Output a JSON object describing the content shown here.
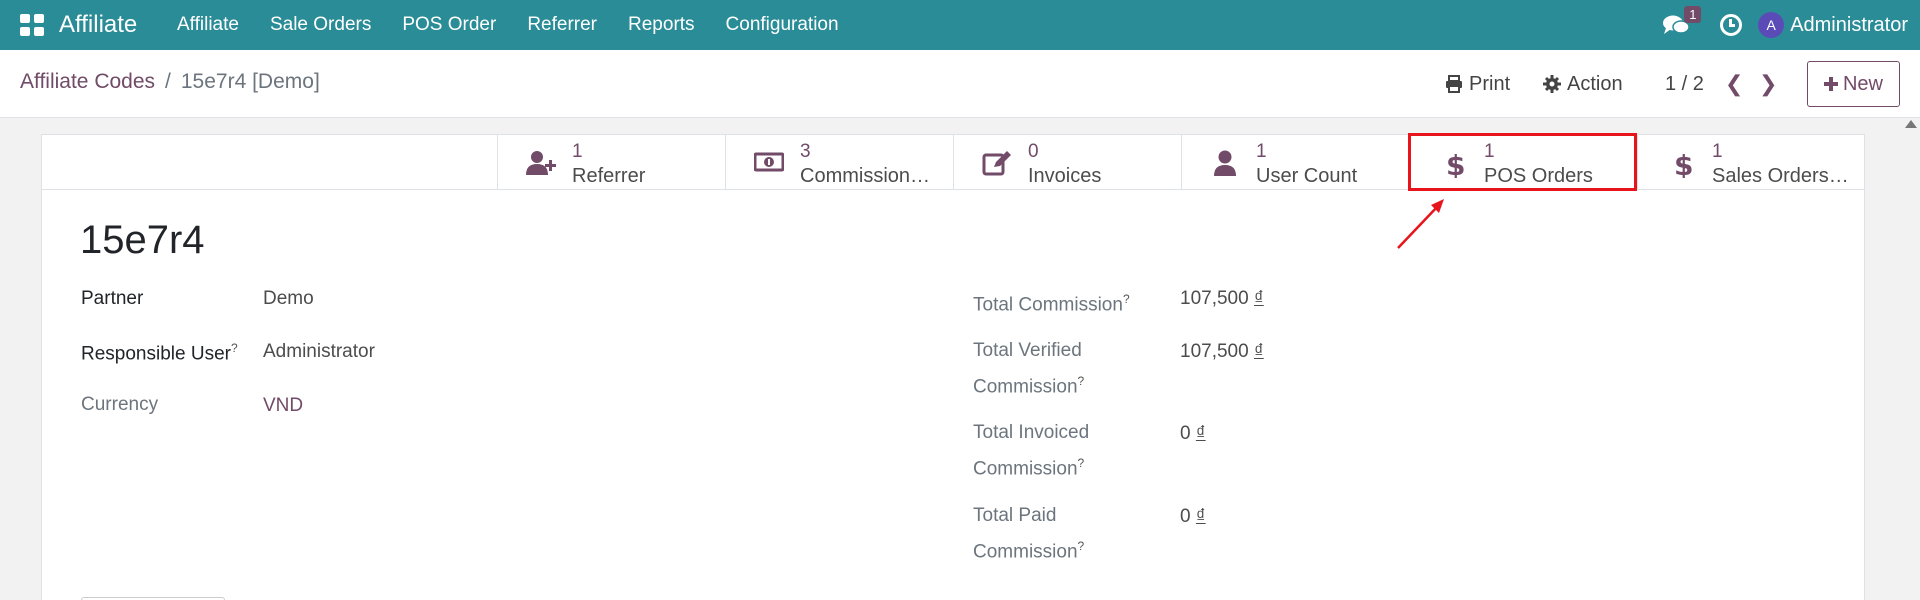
{
  "navbar": {
    "app_name": "Affiliate",
    "menu": [
      "Affiliate",
      "Sale Orders",
      "POS Order",
      "Referrer",
      "Reports",
      "Configuration"
    ],
    "chat_count": "1",
    "avatar_letter": "A",
    "user_name": "Administrator"
  },
  "breadcrumb": {
    "parent": "Affiliate Codes",
    "separator": "/",
    "current": "15e7r4 [Demo]"
  },
  "toolbar": {
    "print_label": "Print",
    "action_label": "Action",
    "pager": "1 / 2",
    "new_label": "New"
  },
  "stat_buttons": [
    {
      "value": "1",
      "label": "Referrer",
      "icon": "user-plus-icon"
    },
    {
      "value": "3",
      "label": "Commission…",
      "icon": "money-bill-icon"
    },
    {
      "value": "0",
      "label": "Invoices",
      "icon": "edit-icon"
    },
    {
      "value": "1",
      "label": "User Count",
      "icon": "user-icon"
    },
    {
      "value": "1",
      "label": "POS Orders",
      "icon": "dollar-icon"
    },
    {
      "value": "1",
      "label": "Sales Orders…",
      "icon": "dollar-icon"
    }
  ],
  "record": {
    "title": "15e7r4",
    "partner_label": "Partner",
    "partner_value": "Demo",
    "responsible_label": "Responsible User",
    "responsible_value": "Administrator",
    "currency_label": "Currency",
    "currency_value": "VND",
    "help_mark": "?",
    "currency_symbol": "₫",
    "total_commission_label": "Total Commission",
    "total_commission_value": "107,500",
    "verified_label_1": "Total Verified",
    "verified_label_2": "Commission",
    "verified_value": "107,500",
    "invoiced_label_1": "Total Invoiced",
    "invoiced_label_2": "Commission",
    "invoiced_value": "0",
    "paid_label_1": "Total Paid",
    "paid_label_2": "Commission",
    "paid_value": "0"
  },
  "colors": {
    "navbar": "#2a8c96",
    "accent": "#714b67",
    "highlight": "#e8141c"
  }
}
